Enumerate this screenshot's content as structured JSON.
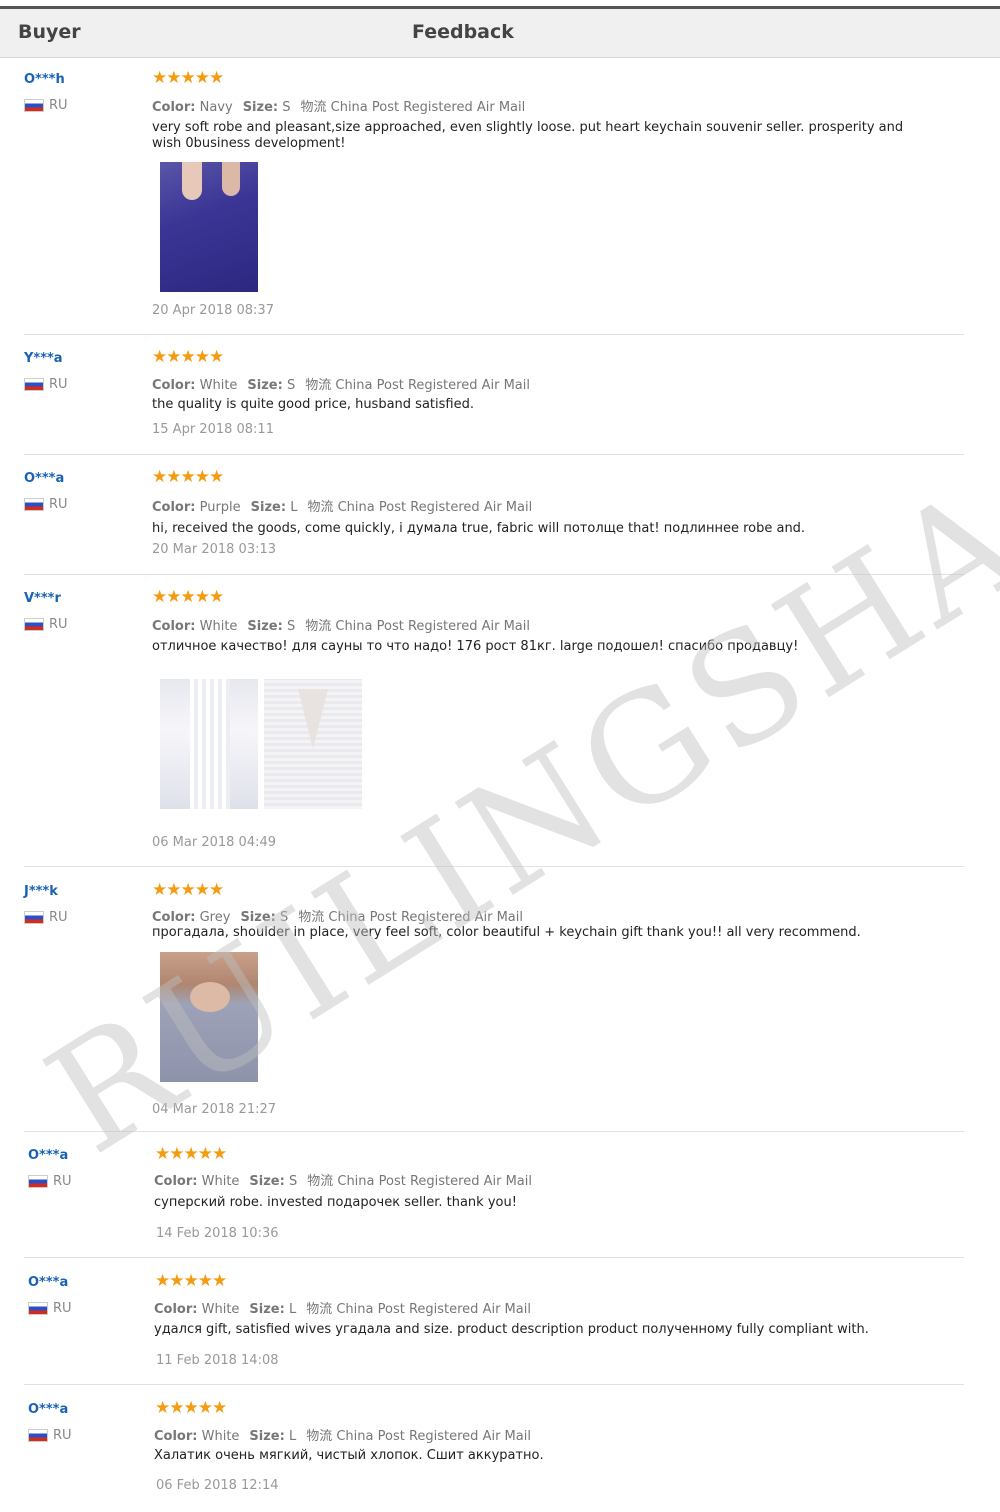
{
  "header": {
    "buyer": "Buyer",
    "feedback": "Feedback"
  },
  "watermark": "RUILINGSHA",
  "reviews": [
    {
      "buyer": "O***h",
      "country": "RU",
      "stars": "★★★★★",
      "color_label": "Color:",
      "color": "Navy",
      "size_label": "Size:",
      "size": "S",
      "shipping": "物流 China Post Registered Air Mail",
      "comment": "very soft robe and pleasant,size approached, even slightly loose. put heart keychain souvenir seller. prosperity and wish 0business development!",
      "date": "20 Apr 2018 08:37"
    },
    {
      "buyer": "Y***a",
      "country": "RU",
      "stars": "★★★★★",
      "color_label": "Color:",
      "color": "White",
      "size_label": "Size:",
      "size": "S",
      "shipping": "物流 China Post Registered Air Mail",
      "comment": "the quality is quite good price, husband satisfied.",
      "date": "15  Apr 2018 08:11"
    },
    {
      "buyer": "O***a",
      "country": "RU",
      "stars": "★★★★★",
      "color_label": "Color:",
      "color": "Purple",
      "size_label": "Size:",
      "size": "L",
      "shipping": "物流 China Post Registered Air Mail",
      "comment": "hi, received the goods, come quickly, i думала true, fabric will потолще that! подлиннее robe and.",
      "date": "20 Mar 2018 03:13"
    },
    {
      "buyer": "V***r",
      "country": "RU",
      "stars": "★★★★★",
      "color_label": "Color:",
      "color": "White",
      "size_label": "Size:",
      "size": "S",
      "shipping": "物流 China Post Registered Air Mail",
      "comment": "отличное качество! для сауны то что надо! 176 рост 81кг. large подошел! спасибо продавцу!",
      "date": "06 Mar 2018 04:49"
    },
    {
      "buyer": "J***k",
      "country": "RU",
      "stars": "★★★★★",
      "color_label": "Color:",
      "color": "Grey",
      "size_label": "Size:",
      "size": "S",
      "shipping": "物流 China Post Registered Air Mail",
      "comment": "прогадала, shoulder in place, very feel soft, color beautiful + keychain gift thank you!! all very recommend.",
      "date": "04 Mar 2018 21:27"
    },
    {
      "buyer": "O***a",
      "country": "RU",
      "stars": "★★★★★",
      "color_label": "Color:",
      "color": "White",
      "size_label": "Size:",
      "size": "S",
      "shipping": "物流 China Post Registered Air Mail",
      "comment": "суперский robe. invested подарочек seller. thank you!",
      "date": "14 Feb 2018 10:36"
    },
    {
      "buyer": "O***a",
      "country": "RU",
      "stars": "★★★★★",
      "color_label": "Color:",
      "color": "White",
      "size_label": "Size:",
      "size": "L",
      "shipping": "物流 China Post Registered Air Mail",
      "comment": "удался gift, satisfied wives угадала and size. product description product полученному fully compliant with.",
      "date": "11 Feb 2018 14:08"
    },
    {
      "buyer": "O***a",
      "country": "RU",
      "stars": "★★★★★",
      "color_label": "Color:",
      "color": "White",
      "size_label": "Size:",
      "size": "L",
      "shipping": "物流 China Post Registered Air Mail",
      "comment": "Халатик очень мягкий, чистый хлопок. Сшит аккуратно.",
      "date": "06 Feb 2018 12:14"
    }
  ]
}
